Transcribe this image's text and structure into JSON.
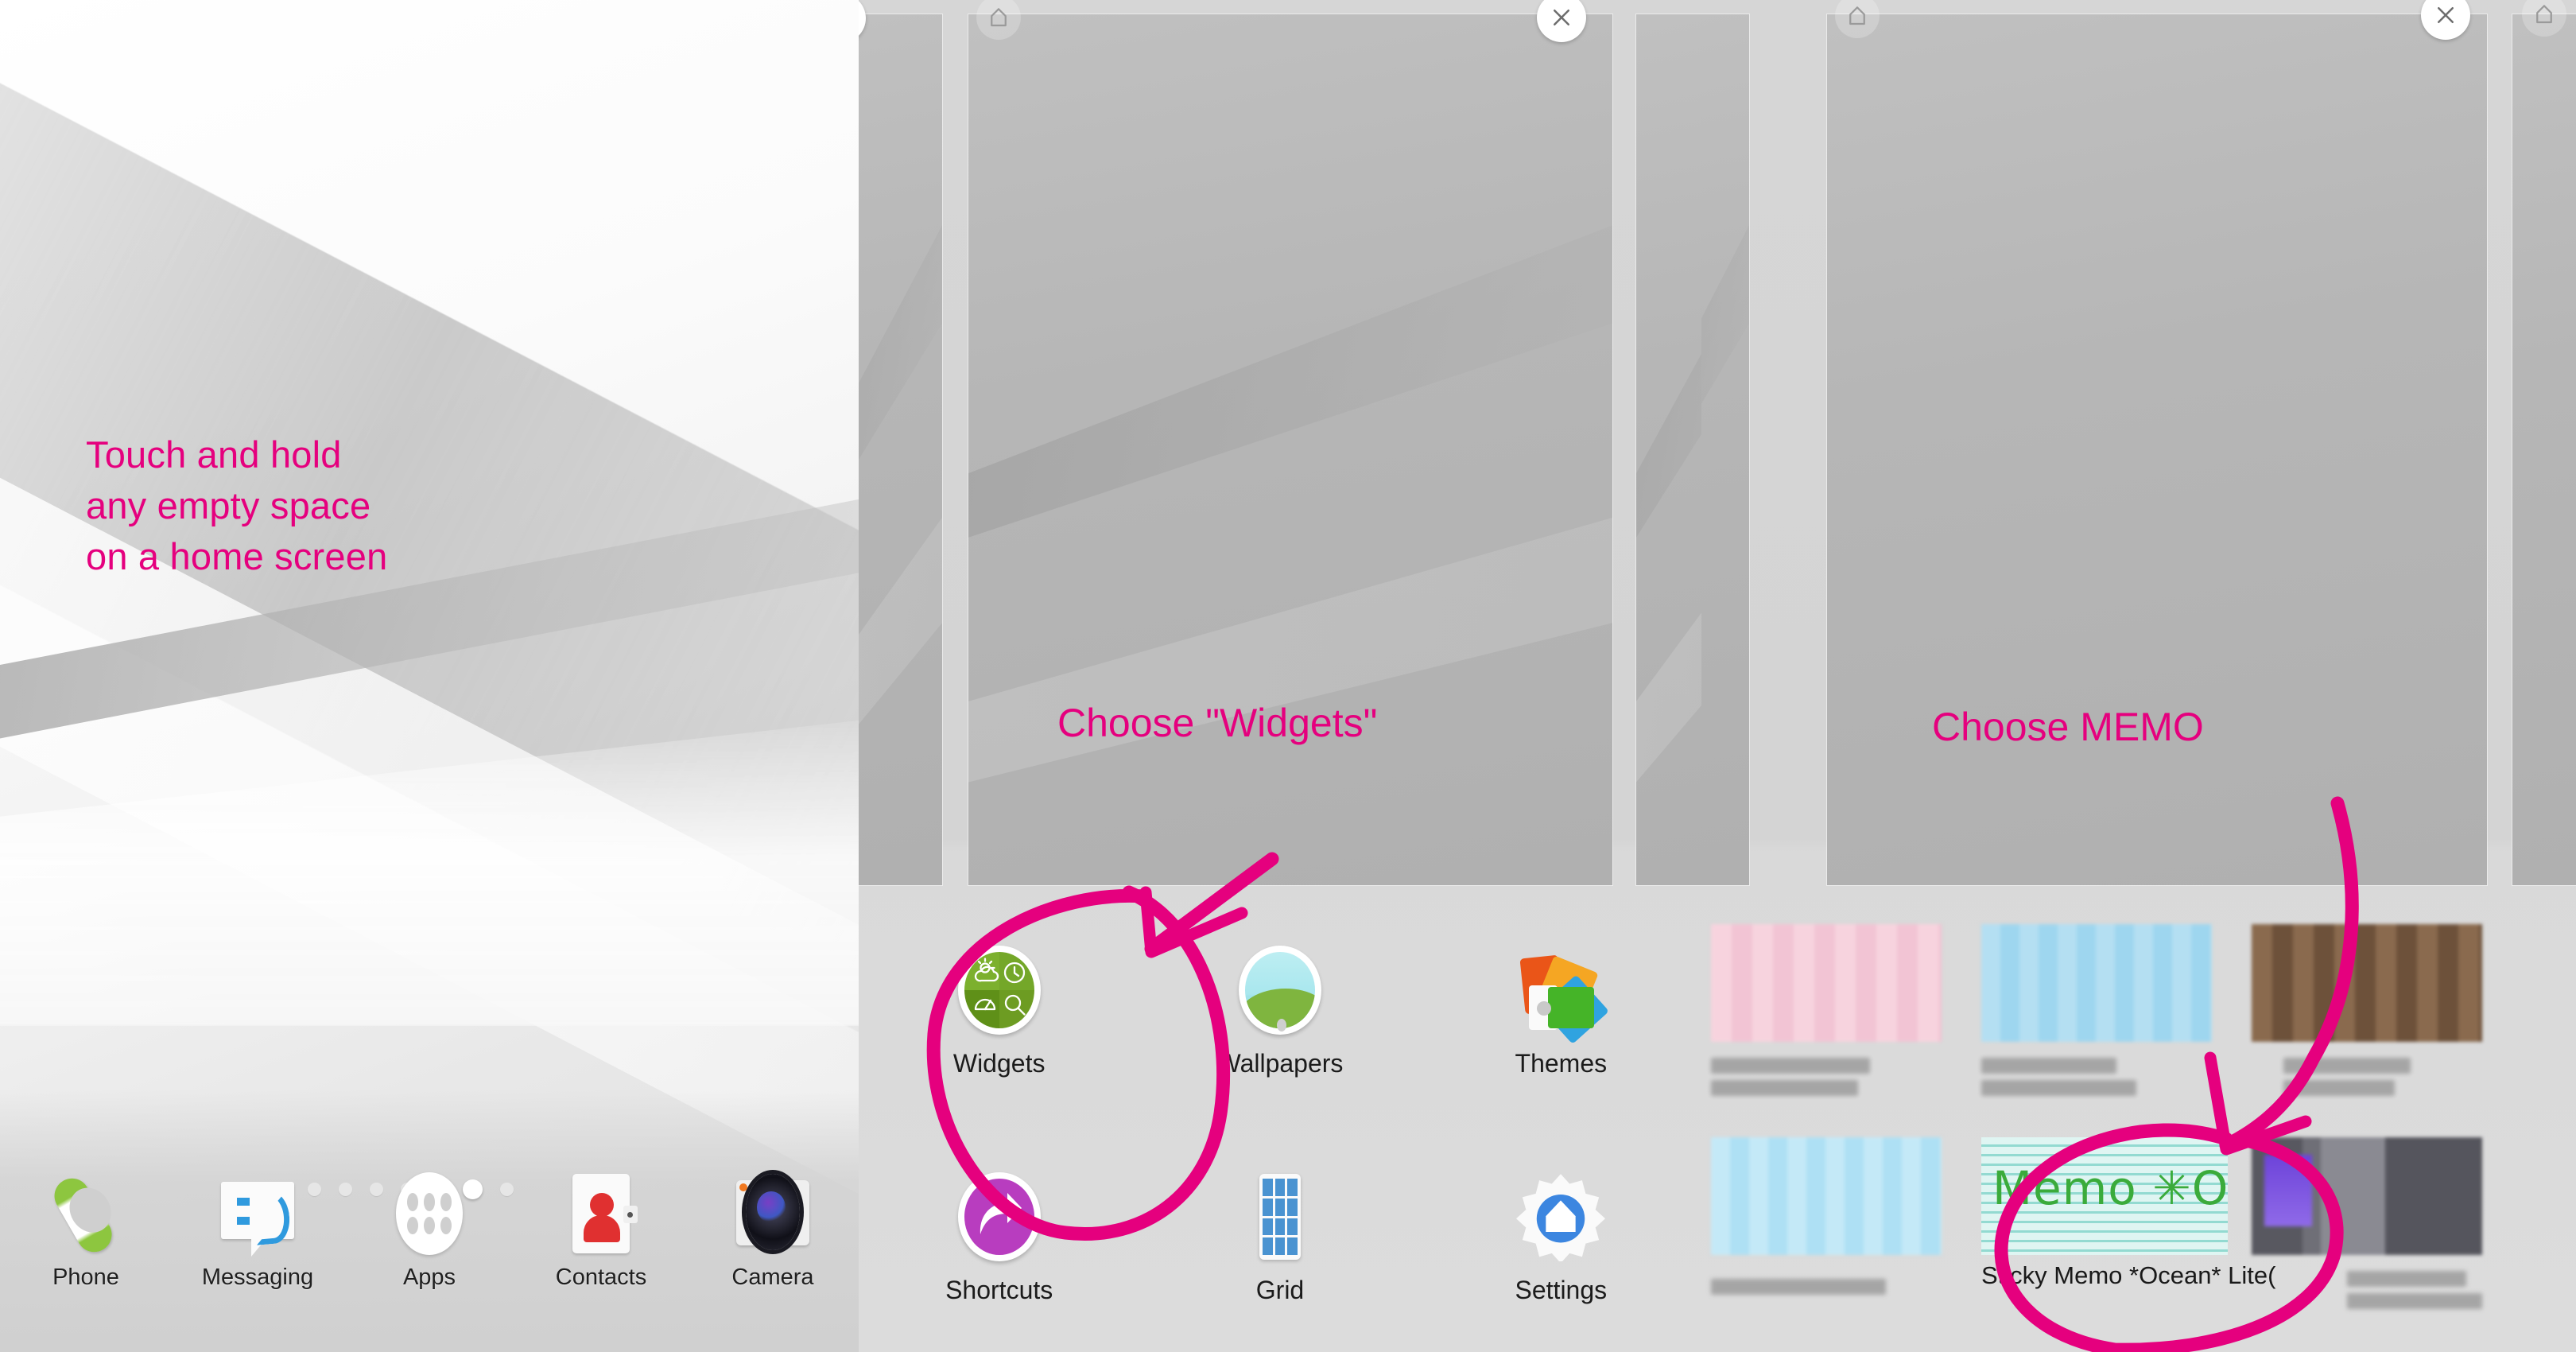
{
  "accent_pink": "#E5007E",
  "panels": {
    "left": {
      "name": "home-screen",
      "callout_lines": [
        "Touch and hold",
        "any empty space",
        "on a home screen"
      ],
      "page_dots": {
        "total": 8,
        "active_index": 6
      },
      "dock": [
        {
          "label": "Phone",
          "icon": "phone-icon"
        },
        {
          "label": "Messaging",
          "icon": "messaging-icon"
        },
        {
          "label": "Apps",
          "icon": "apps-grid-icon"
        },
        {
          "label": "Contacts",
          "icon": "contacts-icon"
        },
        {
          "label": "Camera",
          "icon": "camera-icon"
        }
      ]
    },
    "middle": {
      "name": "home-edit-mode",
      "callout": "Choose \"Widgets\"",
      "close_label": "close-icon",
      "home_label": "home-icon",
      "menu": [
        {
          "label": "Widgets",
          "icon": "widgets-icon"
        },
        {
          "label": "Wallpapers",
          "icon": "wallpapers-icon"
        },
        {
          "label": "Themes",
          "icon": "themes-icon"
        },
        {
          "label": "Shortcuts",
          "icon": "shortcuts-icon"
        },
        {
          "label": "Grid",
          "icon": "grid-icon"
        },
        {
          "label": "Settings",
          "icon": "settings-icon"
        }
      ]
    },
    "right": {
      "name": "widget-picker",
      "callout": "Choose MEMO",
      "close_label": "close-icon",
      "home_label": "home-icon",
      "memo_widget": {
        "preview_text": "Memo ✳Ocean✳",
        "name": "Sticky Memo *Ocean* Lite("
      },
      "widget_tiles": [
        {
          "id": "tile-pink",
          "tint": "#f6cddb",
          "label_blurred": true
        },
        {
          "id": "tile-blue",
          "tint": "#a8dcf0",
          "label_blurred": true
        },
        {
          "id": "tile-photo",
          "tint": "#8a6a4e",
          "label_blurred": true
        },
        {
          "id": "tile-cyan",
          "tint": "#bfe6f5",
          "label_blurred": true
        },
        {
          "id": "tile-dark",
          "tint": "#5a5a63",
          "label_blurred": true
        }
      ]
    }
  }
}
